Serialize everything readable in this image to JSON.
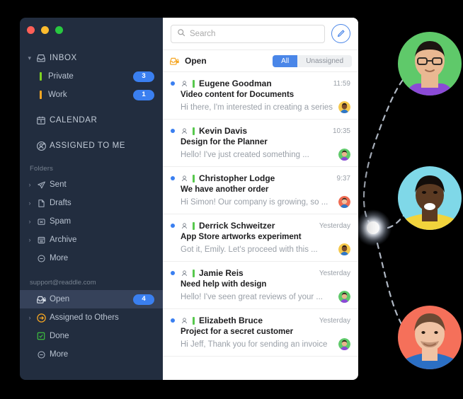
{
  "window": {
    "traffic_lights": [
      "close",
      "minimize",
      "maximize"
    ],
    "colors": {
      "close": "#ff5f57",
      "minimize": "#febc2e",
      "maximize": "#28c840",
      "accent": "#4a86e8",
      "sidebar": "#222d3f",
      "selected_row": "#36425a"
    }
  },
  "sidebar": {
    "top": [
      {
        "label": "INBOX",
        "icon": "inbox-icon",
        "caret": "⌄",
        "badge": null,
        "tag": null
      },
      {
        "label": "Private",
        "icon": null,
        "caret": null,
        "badge": "3",
        "tag": "#7ed321"
      },
      {
        "label": "Work",
        "icon": null,
        "caret": null,
        "badge": "1",
        "tag": "#f5a623"
      },
      {
        "label": "CALENDAR",
        "icon": "calendar-icon",
        "caret": null,
        "badge": null,
        "tag": null
      },
      {
        "label": "ASSIGNED TO ME",
        "icon": "assigned-icon",
        "caret": null,
        "badge": null,
        "tag": null
      }
    ],
    "folders_header": "Folders",
    "folders": [
      {
        "label": "Sent",
        "icon": "send-icon",
        "caret": "›"
      },
      {
        "label": "Drafts",
        "icon": "draft-icon",
        "caret": "›"
      },
      {
        "label": "Spam",
        "icon": "spam-icon",
        "caret": "›"
      },
      {
        "label": "Archive",
        "icon": "archive-icon",
        "caret": "›"
      },
      {
        "label": "More",
        "icon": "more-icon",
        "caret": null
      }
    ],
    "account": "support@readdle.com",
    "shared": [
      {
        "label": "Open",
        "icon": "open-tray-icon",
        "caret": null,
        "badge": "4",
        "selected": true
      },
      {
        "label": "Assigned to Others",
        "icon": "assigned-others-icon",
        "caret": "›",
        "badge": null,
        "selected": false
      },
      {
        "label": "Done",
        "icon": "done-icon",
        "caret": null,
        "badge": null,
        "selected": false
      },
      {
        "label": "More",
        "icon": "more-icon",
        "caret": null,
        "badge": null,
        "selected": false
      }
    ]
  },
  "search": {
    "placeholder": "Search",
    "icon": "search-icon"
  },
  "compose": {
    "icon": "pencil-icon",
    "label": "Compose"
  },
  "list_header": {
    "title": "Open",
    "icon": "open-tray-icon",
    "filters": [
      {
        "label": "All",
        "active": true
      },
      {
        "label": "Unassigned",
        "active": false
      }
    ]
  },
  "mails": [
    {
      "unread": true,
      "sender": "Eugene Goodman",
      "time": "11:59",
      "subject": "Video content for Documents",
      "preview": "Hi there, I'm interested in creating a series",
      "avatar_bg": "#f5c84c",
      "avatar_skin": "#7a4a2a",
      "avatar_hair": "#241a15",
      "avatar_shirt": "#2f77c7"
    },
    {
      "unread": true,
      "sender": "Kevin Davis",
      "time": "10:35",
      "subject": "Design for the Planner",
      "preview": "Hello! I've just created something ...",
      "avatar_bg": "#5fc96a",
      "avatar_skin": "#e8b48c",
      "avatar_hair": "#2b211b",
      "avatar_shirt": "#8b4ad6"
    },
    {
      "unread": true,
      "sender": "Christopher Lodge",
      "time": "9:37",
      "subject": "We have another order",
      "preview": "Hi Simon! Our company is growing, so ...",
      "avatar_bg": "#ef6b52",
      "avatar_skin": "#f0c0a0",
      "avatar_hair": "#3a2a20",
      "avatar_shirt": "#2f77c7"
    },
    {
      "unread": true,
      "sender": "Derrick Schweitzer",
      "time": "Yesterday",
      "subject": "App Store artworks experiment",
      "preview": "Got it, Emily. Let's proceed with this ...",
      "avatar_bg": "#f5c84c",
      "avatar_skin": "#7a4a2a",
      "avatar_hair": "#241a15",
      "avatar_shirt": "#2f77c7"
    },
    {
      "unread": true,
      "sender": "Jamie Reis",
      "time": "Yesterday",
      "subject": "Need help with design",
      "preview": "Hello! I've seen great reviews of your ...",
      "avatar_bg": "#5fc96a",
      "avatar_skin": "#e8b48c",
      "avatar_hair": "#2b211b",
      "avatar_shirt": "#8b4ad6"
    },
    {
      "unread": true,
      "sender": "Elizabeth Bruce",
      "time": "Yesterday",
      "subject": "Project for a secret customer",
      "preview": "Hi Jeff, Thank you for sending an invoice",
      "avatar_bg": "#5fc96a",
      "avatar_skin": "#e8b48c",
      "avatar_hair": "#2b211b",
      "avatar_shirt": "#8b4ad6"
    }
  ],
  "network": {
    "node": {
      "label": "hub-node",
      "color": "#ffffff"
    },
    "avatars": [
      {
        "name": "avatar-top",
        "bg": "#5fc96a",
        "skin": "#e9b892",
        "hair": "#1c1511",
        "shirt": "#8b4ad6",
        "glasses": true
      },
      {
        "name": "avatar-middle",
        "bg": "#7fd8e8",
        "skin": "#5b3a22",
        "hair": "#130d0a",
        "shirt": "#f2d43c",
        "glasses": false
      },
      {
        "name": "avatar-bottom",
        "bg": "#f5705a",
        "skin": "#f0c3a4",
        "hair": "#6b4a33",
        "shirt": "#2b6fc4",
        "glasses": false
      }
    ]
  }
}
